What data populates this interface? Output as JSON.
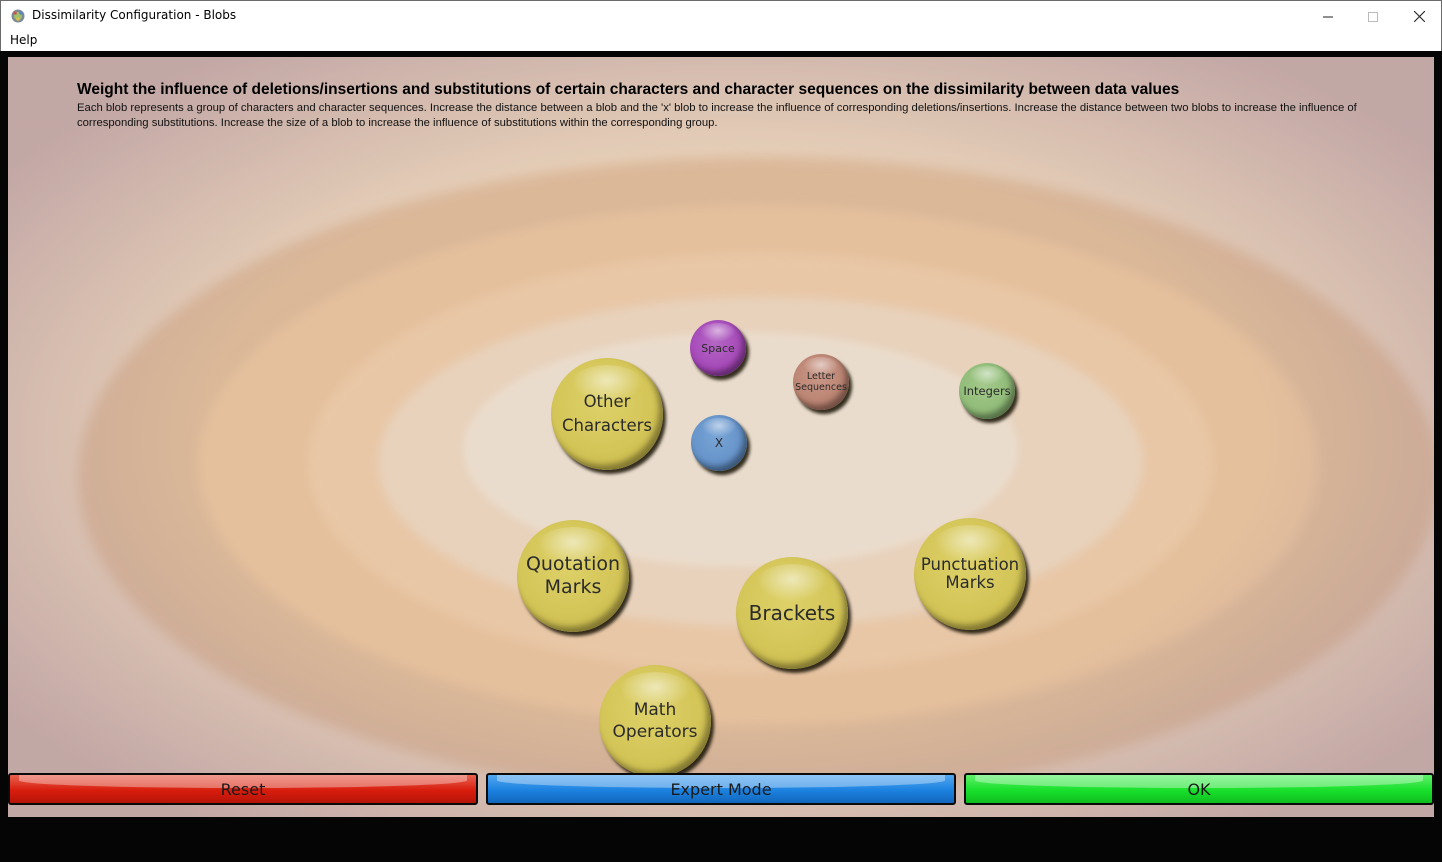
{
  "window": {
    "title": "Dissimilarity Configuration - Blobs",
    "app_icon": "app-gear-icon",
    "controls": [
      "minimize-icon",
      "maximize-icon",
      "close-icon"
    ]
  },
  "menu": {
    "items": [
      {
        "label": "Help"
      }
    ]
  },
  "main": {
    "heading": "Weight the influence of deletions/insertions and substitutions of certain characters and character sequences on the dissimilarity between data values",
    "description": "Each blob represents a group of characters and character sequences. Increase the distance between a blob and the 'x' blob to increase the influence of corresponding deletions/insertions. Increase the distance between two blobs to increase the influence of corresponding substitutions. Increase the size of a blob to increase the influence of substitutions within the corresponding group.",
    "blobs": {
      "space": {
        "label": "Space",
        "color": "#a548b8"
      },
      "letter_sequences": {
        "label": "Letter\nSequences",
        "color": "#bb8472"
      },
      "integers": {
        "label": "Integers",
        "color": "#90bb78"
      },
      "other_characters": {
        "label": "Other\nCharacters",
        "color": "#d4c558"
      },
      "x": {
        "label": "X",
        "color": "#6592c8"
      },
      "quotation_marks": {
        "label": "Quotation\nMarks",
        "color": "#d4c558"
      },
      "brackets": {
        "label": "Brackets",
        "color": "#d4c558"
      },
      "punctuation_marks": {
        "label": "Punctuation\nMarks",
        "color": "#d4c558"
      },
      "math_operators": {
        "label": "Math\nOperators",
        "color": "#d4c558"
      }
    }
  },
  "buttons": {
    "reset": {
      "label": "Reset",
      "color": "#d81d0d"
    },
    "expert": {
      "label": "Expert Mode",
      "color": "#1c82e0"
    },
    "ok": {
      "label": "OK",
      "color": "#18e02b"
    }
  }
}
